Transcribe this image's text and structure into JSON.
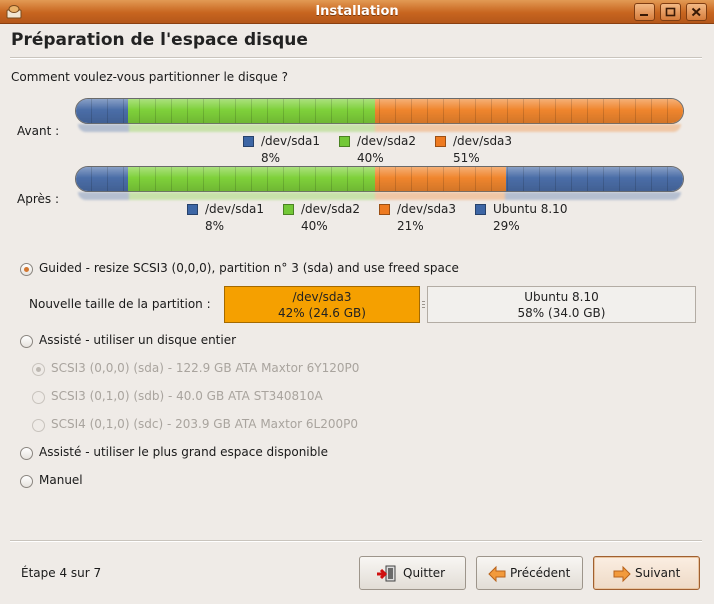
{
  "window": {
    "title": "Installation"
  },
  "page_title": "Préparation de l'espace disque",
  "question": "Comment voulez-vous partitionner le disque ?",
  "colors": {
    "blue": "#4b6ea8",
    "green": "#7fd13b",
    "orange": "#f0862e",
    "selected_partition": "#f5a000"
  },
  "before": {
    "label": "Avant :",
    "segments": [
      {
        "color": "#4b6ea8",
        "fraction": 0.085
      },
      {
        "color": "#7fd13b",
        "fraction": 0.408
      },
      {
        "color": "#f0862e",
        "fraction": 0.507
      }
    ],
    "legend": [
      {
        "name": "/dev/sda1",
        "pct": "8%",
        "color": "#3d66a5"
      },
      {
        "name": "/dev/sda2",
        "pct": "40%",
        "color": "#73c837"
      },
      {
        "name": "/dev/sda3",
        "pct": "51%",
        "color": "#ee7a20"
      }
    ]
  },
  "after": {
    "label": "Après :",
    "segments": [
      {
        "color": "#4b6ea8",
        "fraction": 0.085
      },
      {
        "color": "#7fd13b",
        "fraction": 0.408
      },
      {
        "color": "#f0862e",
        "fraction": 0.215
      },
      {
        "color": "#4b6ea8",
        "fraction": 0.292
      }
    ],
    "legend": [
      {
        "name": "/dev/sda1",
        "pct": "8%",
        "color": "#3d66a5"
      },
      {
        "name": "/dev/sda2",
        "pct": "40%",
        "color": "#73c837"
      },
      {
        "name": "/dev/sda3",
        "pct": "21%",
        "color": "#ee7a20"
      },
      {
        "name": "Ubuntu 8.10",
        "pct": "29%",
        "color": "#3d66a5"
      }
    ]
  },
  "options": {
    "guided_resize": {
      "label": "Guided - resize SCSI3 (0,0,0), partition n° 3 (sda) and use freed space",
      "selected": true
    },
    "new_size_label": "Nouvelle taille de la partition :",
    "resize": {
      "left": {
        "name": "/dev/sda3",
        "value": "42% (24.6 GB)",
        "fraction": 0.42
      },
      "right": {
        "name": "Ubuntu 8.10",
        "value": "58% (34.0 GB)",
        "fraction": 0.58
      }
    },
    "whole_disk": {
      "label": "Assisté - utiliser un disque entier",
      "selected": false
    },
    "disks": [
      {
        "label": "SCSI3 (0,0,0) (sda) - 122.9 GB ATA Maxtor 6Y120P0",
        "selected": true,
        "disabled": true
      },
      {
        "label": "SCSI3 (0,1,0) (sdb) - 40.0 GB ATA ST340810A",
        "selected": false,
        "disabled": true
      },
      {
        "label": "SCSI4 (0,1,0) (sdc) - 203.9 GB ATA Maxtor 6L200P0",
        "selected": false,
        "disabled": true
      }
    ],
    "largest_free": {
      "label": "Assisté - utiliser le plus grand espace disponible",
      "selected": false
    },
    "manual": {
      "label": "Manuel",
      "selected": false
    }
  },
  "footer": {
    "step": "Étape 4 sur 7",
    "quit": "Quitter",
    "previous": "Précédent",
    "next": "Suivant"
  }
}
